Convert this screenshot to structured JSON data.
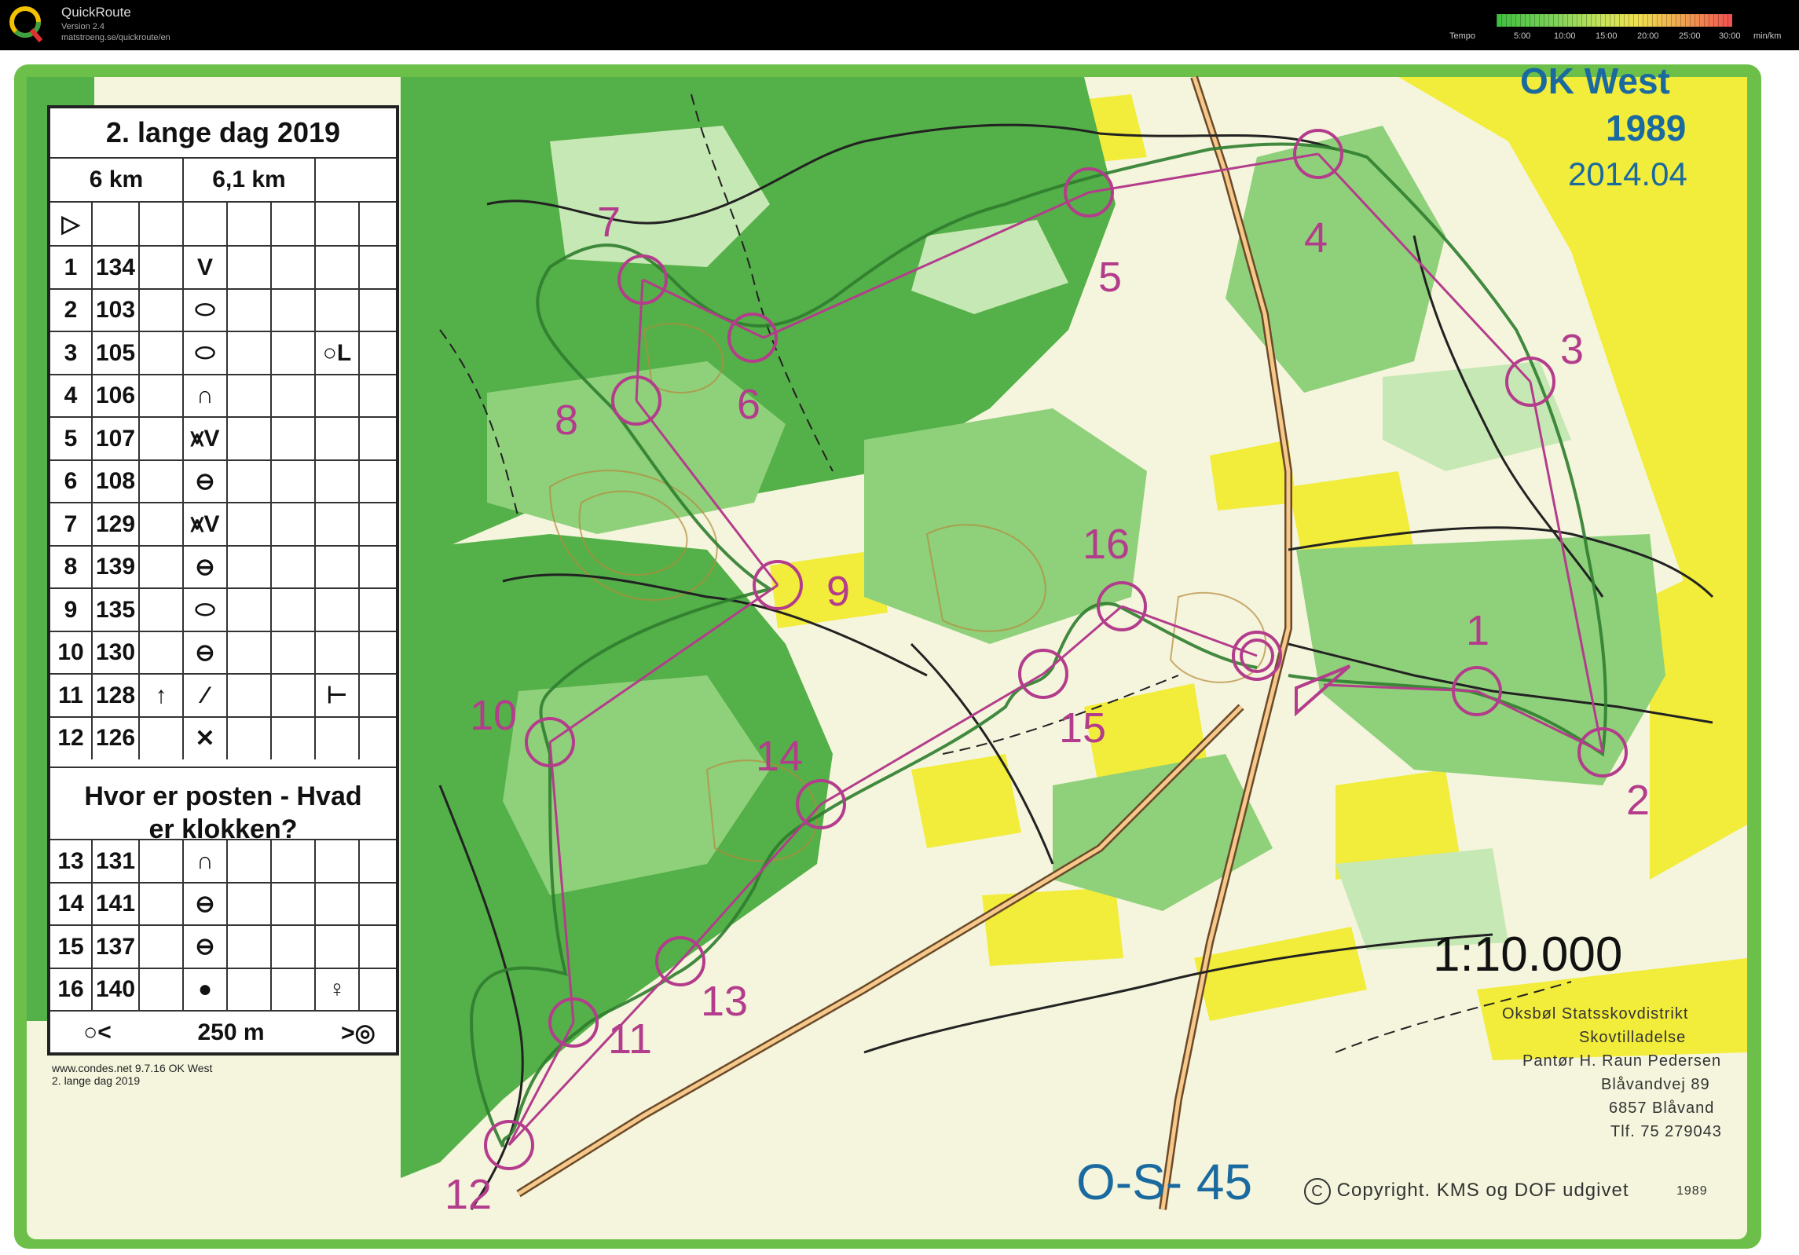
{
  "app": {
    "name": "QuickRoute",
    "version": "Version 2.4",
    "url": "matstroeng.se/quickroute/en"
  },
  "tempo": {
    "label": "Tempo",
    "ticks": [
      "5:00",
      "10:00",
      "15:00",
      "20:00",
      "25:00",
      "30:00"
    ],
    "unit": "min/km"
  },
  "description_sheet": {
    "title": "2. lange dag 2019",
    "length_a": "6 km",
    "length_b": "6,1 km",
    "start_symbol": "▷",
    "controls_part1": [
      {
        "num": "1",
        "code": "134",
        "symbol": "V",
        "extra": ""
      },
      {
        "num": "2",
        "code": "103",
        "symbol": "⬭",
        "extra": ""
      },
      {
        "num": "3",
        "code": "105",
        "symbol": "⬭",
        "extra": "○L"
      },
      {
        "num": "4",
        "code": "106",
        "symbol": "∩",
        "extra": ""
      },
      {
        "num": "5",
        "code": "107",
        "symbol": "⩙V",
        "extra": ""
      },
      {
        "num": "6",
        "code": "108",
        "symbol": "⊖",
        "extra": ""
      },
      {
        "num": "7",
        "code": "129",
        "symbol": "⩙V",
        "extra": ""
      },
      {
        "num": "8",
        "code": "139",
        "symbol": "⊖",
        "extra": ""
      },
      {
        "num": "9",
        "code": "135",
        "symbol": "⬭",
        "extra": ""
      },
      {
        "num": "10",
        "code": "130",
        "symbol": "⊖",
        "extra": ""
      },
      {
        "num": "11",
        "code": "128",
        "symbol": "⁄",
        "extra": "⊢",
        "dir": "↑"
      },
      {
        "num": "12",
        "code": "126",
        "symbol": "✕",
        "extra": ""
      }
    ],
    "section_title": "Hvor er posten - Hvad er klokken?",
    "controls_part2": [
      {
        "num": "13",
        "code": "131",
        "symbol": "∩",
        "extra": ""
      },
      {
        "num": "14",
        "code": "141",
        "symbol": "⊖",
        "extra": ""
      },
      {
        "num": "15",
        "code": "137",
        "symbol": "⊖",
        "extra": ""
      },
      {
        "num": "16",
        "code": "140",
        "symbol": "●",
        "extra": "♀"
      }
    ],
    "finish": {
      "left_symbol": "○<",
      "distance": "250 m",
      "right_symbol": ">◎"
    }
  },
  "event_note": {
    "line1": "www.condes.net 9.7.16 OK West",
    "line2": "2. lange dag 2019"
  },
  "map_text": {
    "club": "OK West",
    "year": "1989",
    "revision": "2014.04",
    "scale": "1:10.000",
    "sheet_id": "O-S- 45",
    "copyright": "Copyright. KMS og DOF udgivet",
    "copyright_year": "1989",
    "owner_lines": [
      "Oksbøl Statsskovdistrikt",
      "Skovtilladelse",
      "Pantør H. Raun Pedersen",
      "Blåvandvej 89",
      "6857 Blåvand",
      "Tlf. 75 279043"
    ]
  },
  "course": {
    "color": "#b43c8c",
    "control_labels": [
      "1",
      "2",
      "3",
      "4",
      "5",
      "6",
      "7",
      "8",
      "9",
      "10",
      "11",
      "12",
      "13",
      "14",
      "15",
      "16"
    ]
  }
}
